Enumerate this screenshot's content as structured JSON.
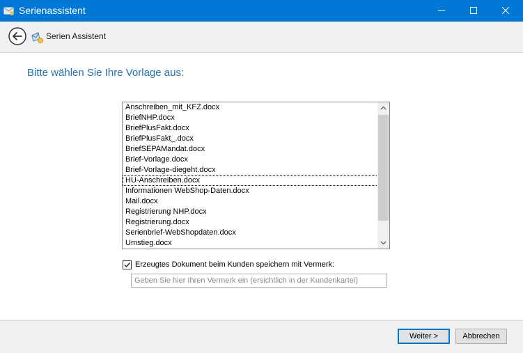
{
  "window": {
    "title": "Serienassistent",
    "controls": [
      "minimize-icon",
      "maximize-icon",
      "close-icon"
    ]
  },
  "header": {
    "back_icon": "back-arrow-icon",
    "wizard_icon": "mail-merge-icon",
    "title": "Serien Assistent"
  },
  "main": {
    "heading": "Bitte wählen Sie Ihre Vorlage aus:",
    "templates": [
      "Anschreiben_mit_KFZ.docx",
      "BriefNHP.docx",
      "BriefPlusFakt.docx",
      "BriefPlusFakt_.docx",
      "BriefSEPAMandat.docx",
      "Brief-Vorlage.docx",
      "Brief-Vorlage-diegeht.docx",
      "HU-Anschreiben.docx",
      "Informationen WebShop-Daten.docx",
      "Mail.docx",
      "Registrierung NHP.docx",
      "Registrierung.docx",
      "Serienbrief-WebShopdaten.docx",
      "Umstieg.docx"
    ],
    "focused_template": "HU-Anschreiben.docx",
    "save_checkbox": {
      "label": "Erzeugtes Dokument beim Kunden speichern mit Vermerk:",
      "checked": true
    },
    "vermerk_input": {
      "value": "",
      "placeholder": "Geben Sie hier Ihren Vermerk ein (ersichtlich in der Kundenkartei)"
    }
  },
  "footer": {
    "next_label": "Weiter >",
    "cancel_label": "Abbrechen"
  },
  "colors": {
    "titlebar": "#0078d7",
    "heading": "#1e6fb8"
  }
}
